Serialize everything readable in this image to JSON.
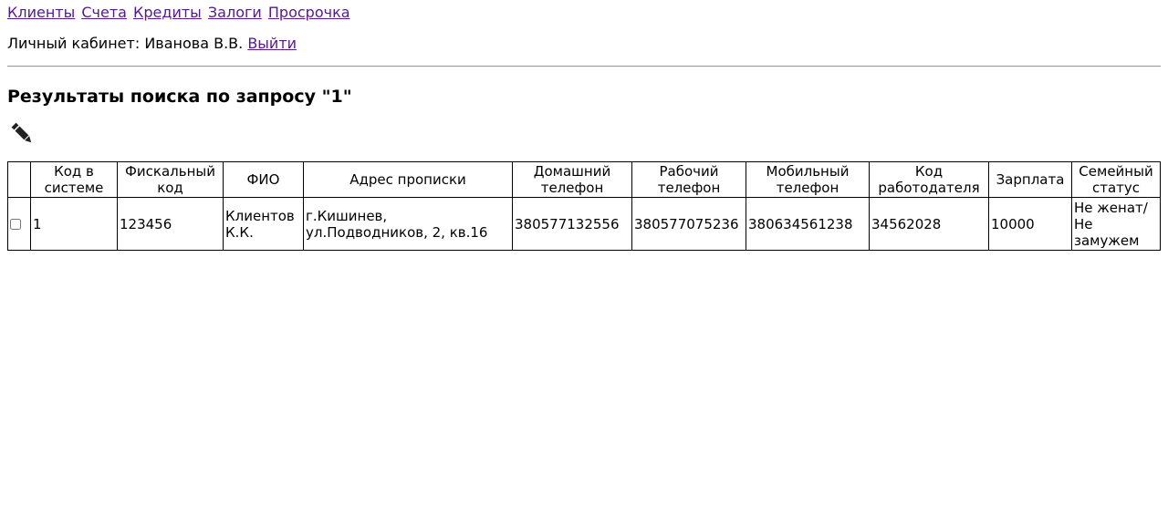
{
  "nav": {
    "items": [
      {
        "label": "Клиенты"
      },
      {
        "label": "Счета"
      },
      {
        "label": "Кредиты"
      },
      {
        "label": "Залоги"
      },
      {
        "label": "Просрочка"
      }
    ]
  },
  "account": {
    "prefix": "Личный кабинет:",
    "user": "Иванова В.В.",
    "logout_label": "Выйти"
  },
  "heading": "Результаты поиска по запросу \"1\"",
  "toolbar": {
    "edit_icon": "pencil-icon"
  },
  "table": {
    "headers": [
      {
        "key": "select",
        "label": ""
      },
      {
        "key": "id",
        "label": "Код в системе"
      },
      {
        "key": "fiscal",
        "label": "Фискальный код"
      },
      {
        "key": "name",
        "label": "ФИО"
      },
      {
        "key": "address",
        "label": "Адрес прописки"
      },
      {
        "key": "home_phone",
        "label": "Домашний телефон"
      },
      {
        "key": "work_phone",
        "label": "Рабочий телефон"
      },
      {
        "key": "mobile_phone",
        "label": "Мобильный телефон"
      },
      {
        "key": "employer",
        "label": "Код работодателя"
      },
      {
        "key": "salary",
        "label": "Зарплата"
      },
      {
        "key": "marital",
        "label": "Семейный статус"
      }
    ],
    "rows": [
      {
        "selected": false,
        "id": "1",
        "fiscal": "123456",
        "name": "Клиентов К.К.",
        "address": "г.Кишинев, ул.Подводников, 2, кв.16",
        "home_phone": "380577132556",
        "work_phone": "380577075236",
        "mobile_phone": "380634561238",
        "employer": "34562028",
        "salary": "10000",
        "marital": "Не женат/Не замужем"
      }
    ]
  }
}
